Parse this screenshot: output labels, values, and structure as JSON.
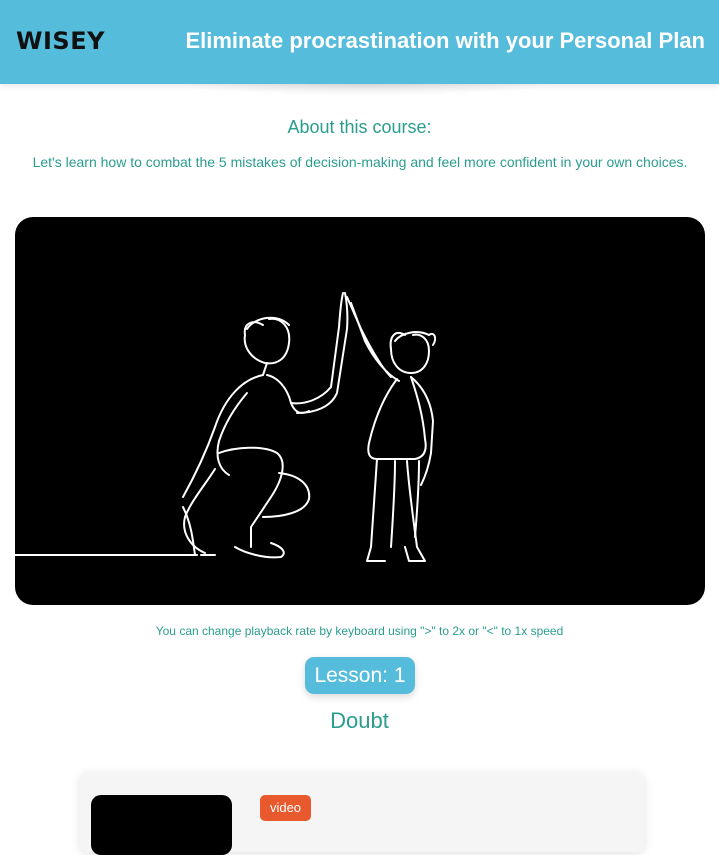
{
  "header": {
    "logo": "WISEY",
    "title": "Eliminate procrastination with your Personal Plan",
    "background_color": "#55bcdb"
  },
  "about": {
    "title": "About this course:",
    "description": "Let's learn how to combat the 5 mistakes of decision-making and feel more confident in your own choices."
  },
  "video": {
    "playback_hint": "You can change playback rate by keyboard using \">\" to 2x or \"<\" to 1x speed"
  },
  "lesson": {
    "badge": "Lesson: 1",
    "name": "Doubt"
  },
  "lesson_card": {
    "type_badge": "video",
    "type_badge_color": "#e85a2e"
  },
  "colors": {
    "accent_text": "#2a9d8f",
    "accent_bg": "#55bcdb"
  }
}
